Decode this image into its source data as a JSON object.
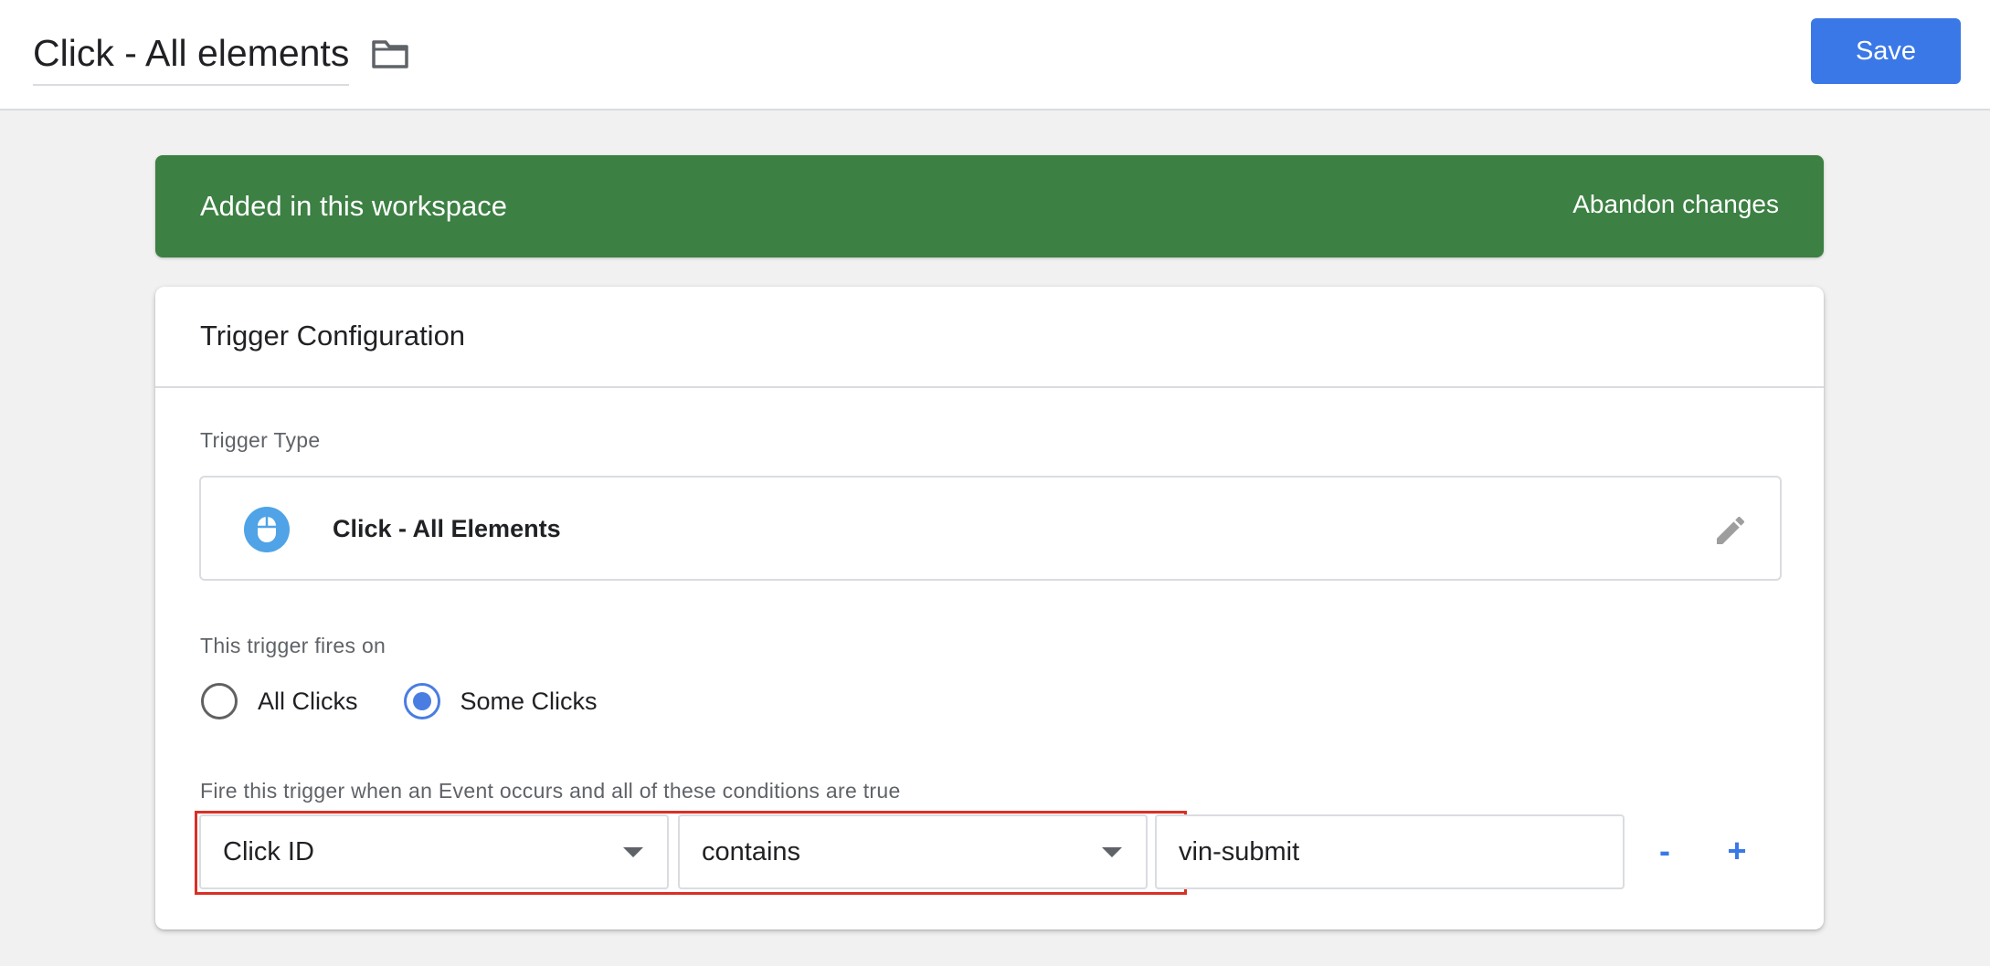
{
  "header": {
    "title": "Click - All elements",
    "folder_icon": "folder-icon",
    "save_label": "Save"
  },
  "banner": {
    "message": "Added in this workspace",
    "action_label": "Abandon changes",
    "color": "#3c8043"
  },
  "card": {
    "title": "Trigger Configuration",
    "trigger_type_label": "Trigger Type",
    "trigger_type": {
      "name": "Click - All Elements",
      "icon": "mouse-icon",
      "edit_icon": "pencil-icon"
    },
    "fires_on_label": "This trigger fires on",
    "fires_on_options": [
      {
        "label": "All Clicks",
        "selected": false
      },
      {
        "label": "Some Clicks",
        "selected": true
      }
    ],
    "condition_label": "Fire this trigger when an Event occurs and all of these conditions are true",
    "condition": {
      "variable": "Click ID",
      "operator": "contains",
      "value": "vin-submit",
      "remove_label": "-",
      "add_label": "+"
    }
  },
  "colors": {
    "accent": "#3b78e7",
    "highlight": "#d93025"
  }
}
